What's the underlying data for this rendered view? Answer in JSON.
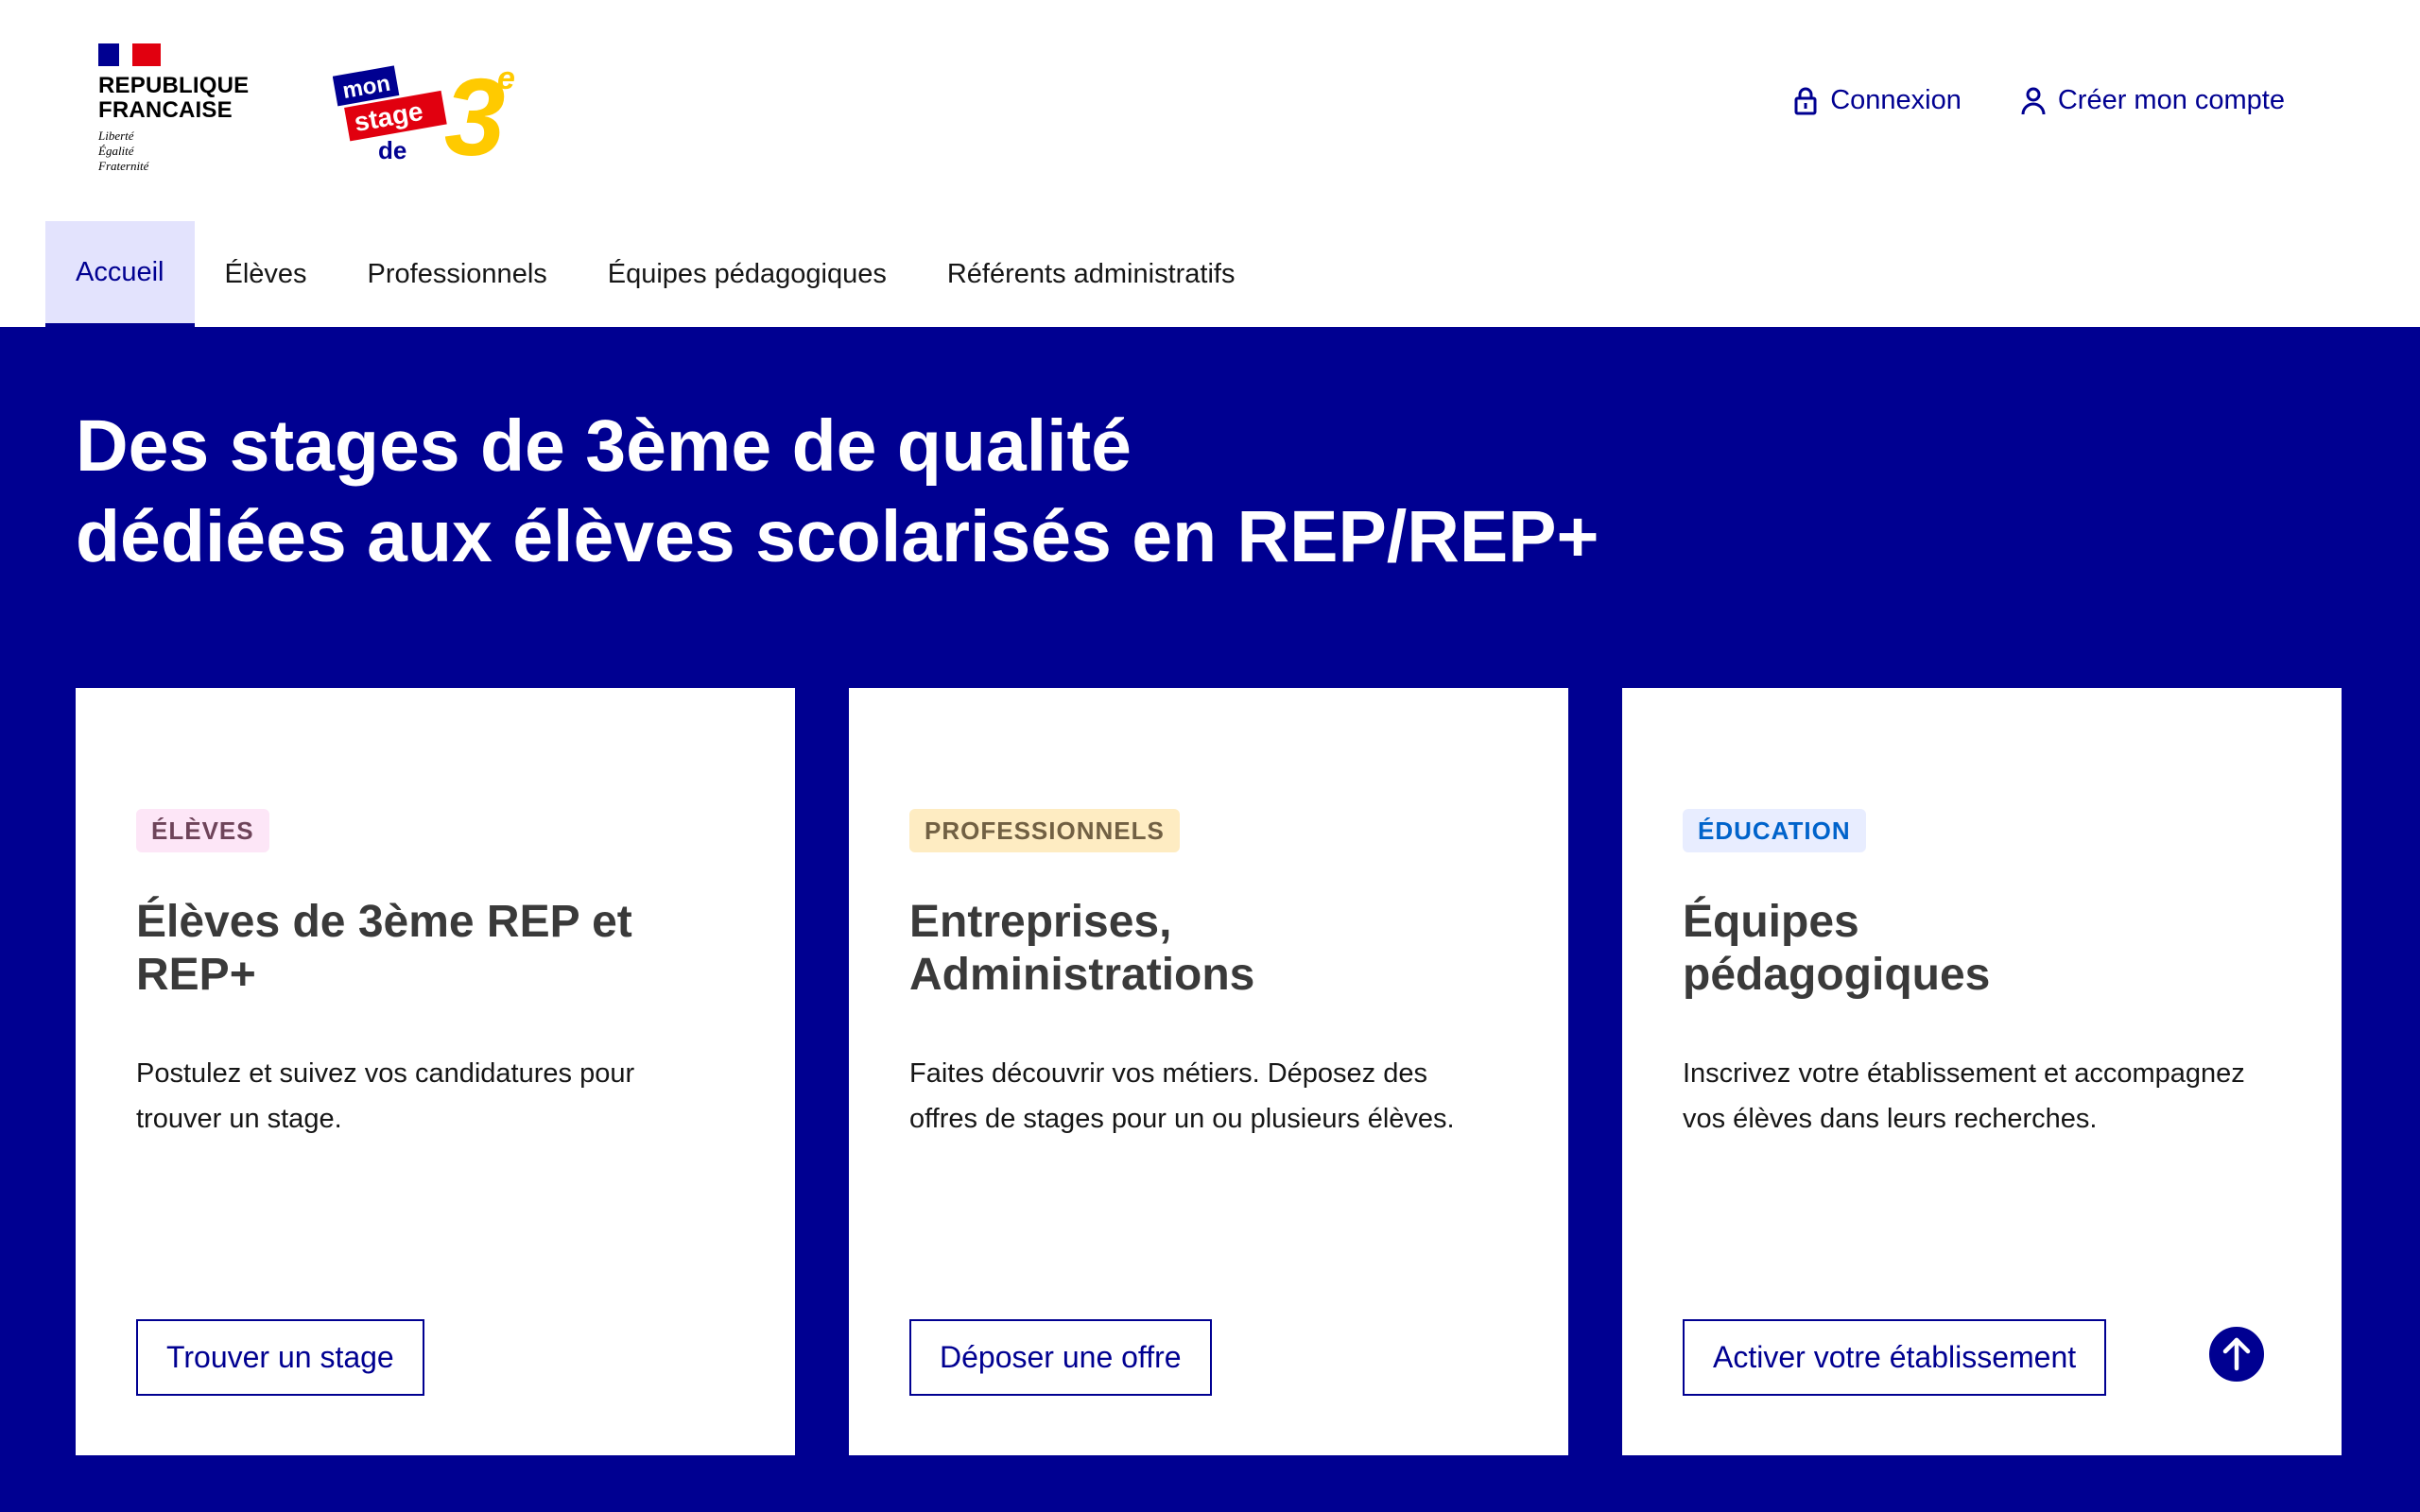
{
  "header": {
    "gov": {
      "name_lines": [
        "REPUBLIQUE",
        "FRANCAISE"
      ],
      "motto_lines": [
        "Liberté",
        "Égalité",
        "Fraternité"
      ]
    },
    "brand": {
      "logo_words": [
        "mon",
        "stage",
        "de",
        "3",
        "e"
      ],
      "colors": {
        "navy": "#000091",
        "red": "#e1000f",
        "yellow": "#ffca00"
      }
    },
    "tools": {
      "login_label": "Connexion",
      "login_icon": "lock-icon",
      "signup_label": "Créer mon compte",
      "signup_icon": "user-icon"
    }
  },
  "nav": {
    "items": [
      {
        "label": "Accueil",
        "active": true
      },
      {
        "label": "Élèves",
        "active": false
      },
      {
        "label": "Professionnels",
        "active": false
      },
      {
        "label": "Équipes pédagogiques",
        "active": false
      },
      {
        "label": "Référents administratifs",
        "active": false
      }
    ]
  },
  "hero": {
    "title_lines": [
      "Des stages de 3ème de qualité",
      "dédiées aux élèves scolarisés en REP/REP+"
    ]
  },
  "cards": [
    {
      "badge": "ÉLÈVES",
      "title_lines": [
        "Élèves de 3ème REP et",
        "REP+"
      ],
      "desc_lines": [
        "Postulez et suivez vos candidatures pour",
        "trouver un stage."
      ],
      "button": "Trouver un stage"
    },
    {
      "badge": "PROFESSIONNELS",
      "title_lines": [
        "Entreprises,",
        "Administrations"
      ],
      "desc_lines": [
        "Faites découvrir vos métiers. Déposez des",
        "offres de stages pour un ou plusieurs élèves."
      ],
      "button": "Déposer une offre"
    },
    {
      "badge": "ÉDUCATION",
      "title_lines": [
        "Équipes",
        "pédagogiques"
      ],
      "desc_lines": [
        "Inscrivez votre établissement et accompagnez",
        "vos élèves dans leurs recherches."
      ],
      "button": "Activer votre établissement"
    }
  ],
  "scroll_top": {
    "icon": "arrow-up-icon"
  },
  "theme": {
    "primary": "#000091",
    "hero_bg": "#000091",
    "active_nav_bg": "#e3e3fd"
  }
}
